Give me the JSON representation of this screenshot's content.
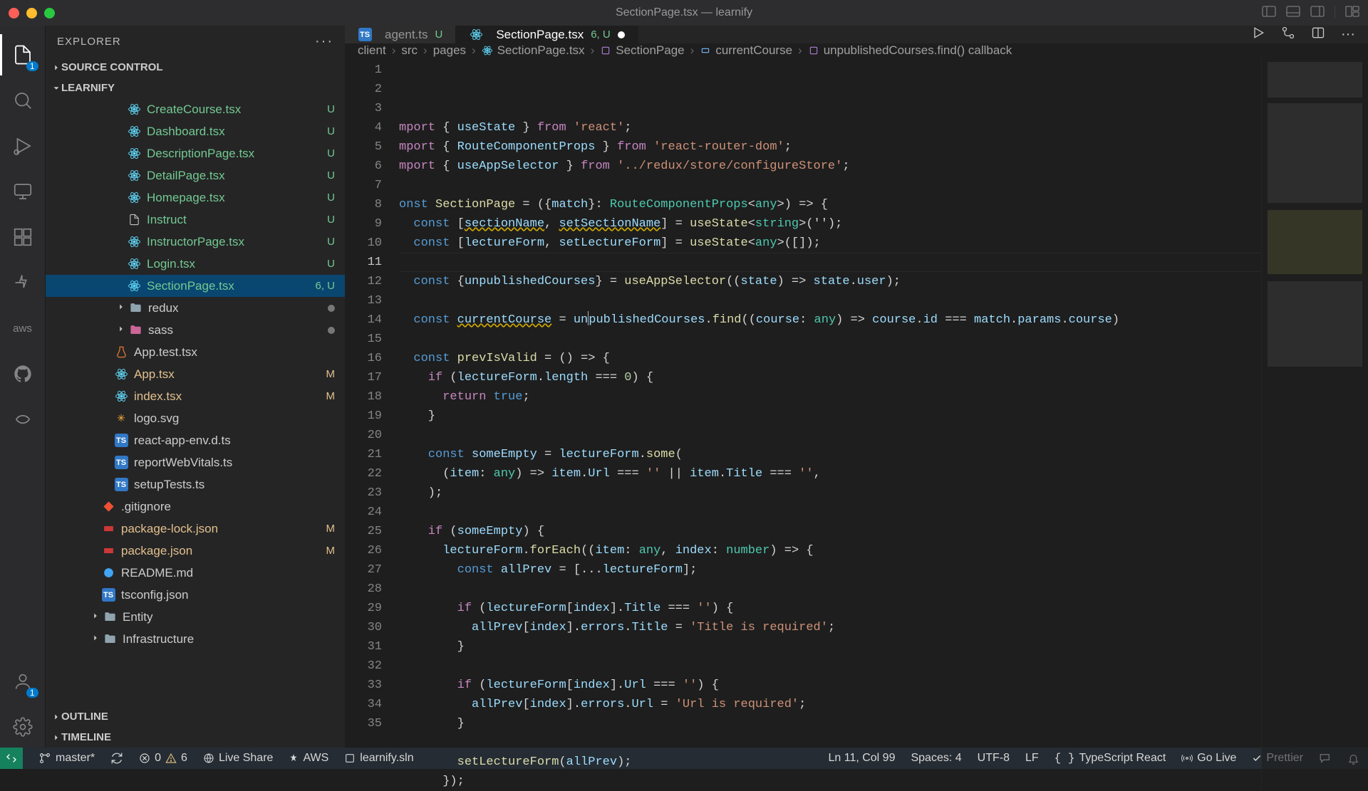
{
  "title": "SectionPage.tsx — learnify",
  "activity": {
    "explorer_badge": "1",
    "accounts_badge": "1"
  },
  "explorer": {
    "title": "EXPLORER",
    "sections": {
      "source_control": "SOURCE CONTROL",
      "project": "LEARNIFY",
      "outline": "OUTLINE",
      "timeline": "TIMELINE"
    },
    "tree_scm_redux": "●",
    "tree_scm_sass": "●",
    "items": [
      {
        "label": "CreateCourse.tsx",
        "indent": 114,
        "icon": "react",
        "scm": "U"
      },
      {
        "label": "Dashboard.tsx",
        "indent": 114,
        "icon": "react",
        "scm": "U"
      },
      {
        "label": "DescriptionPage.tsx",
        "indent": 114,
        "icon": "react",
        "scm": "U"
      },
      {
        "label": "DetailPage.tsx",
        "indent": 114,
        "icon": "react",
        "scm": "U"
      },
      {
        "label": "Homepage.tsx",
        "indent": 114,
        "icon": "react",
        "scm": "U"
      },
      {
        "label": "Instruct",
        "indent": 114,
        "icon": "file",
        "scm": "U"
      },
      {
        "label": "InstructorPage.tsx",
        "indent": 114,
        "icon": "react",
        "scm": "U"
      },
      {
        "label": "Login.tsx",
        "indent": 114,
        "icon": "react",
        "scm": "U"
      },
      {
        "label": "SectionPage.tsx",
        "indent": 114,
        "icon": "react",
        "scm": "6, U",
        "active": true
      },
      {
        "label": "redux",
        "indent": 96,
        "icon": "folder",
        "chev": true,
        "dot": true
      },
      {
        "label": "sass",
        "indent": 96,
        "icon": "sass-folder",
        "chev": true,
        "dot": true
      },
      {
        "label": "App.test.tsx",
        "indent": 96,
        "icon": "test",
        "scm": ""
      },
      {
        "label": "App.tsx",
        "indent": 96,
        "icon": "react",
        "scm": "M"
      },
      {
        "label": "index.tsx",
        "indent": 96,
        "icon": "react",
        "scm": "M"
      },
      {
        "label": "logo.svg",
        "indent": 96,
        "icon": "svg",
        "scm": ""
      },
      {
        "label": "react-app-env.d.ts",
        "indent": 96,
        "icon": "ts",
        "scm": ""
      },
      {
        "label": "reportWebVitals.ts",
        "indent": 96,
        "icon": "ts",
        "scm": ""
      },
      {
        "label": "setupTests.ts",
        "indent": 96,
        "icon": "ts",
        "scm": ""
      },
      {
        "label": ".gitignore",
        "indent": 78,
        "icon": "git",
        "scm": ""
      },
      {
        "label": "package-lock.json",
        "indent": 78,
        "icon": "npm",
        "scm": "M"
      },
      {
        "label": "package.json",
        "indent": 78,
        "icon": "npm",
        "scm": "M"
      },
      {
        "label": "README.md",
        "indent": 78,
        "icon": "info",
        "scm": ""
      },
      {
        "label": "tsconfig.json",
        "indent": 78,
        "icon": "tsj",
        "scm": ""
      },
      {
        "label": "Entity",
        "indent": 60,
        "icon": "folder",
        "chev": true
      },
      {
        "label": "Infrastructure",
        "indent": 60,
        "icon": "folder",
        "chev": true
      }
    ]
  },
  "tabs": [
    {
      "label": "agent.ts",
      "scm": "U",
      "icon": "ts",
      "active": false
    },
    {
      "label": "SectionPage.tsx",
      "scm": "6, U",
      "icon": "react",
      "active": true,
      "modified": true
    }
  ],
  "breadcrumbs": [
    {
      "label": "client"
    },
    {
      "label": "src"
    },
    {
      "label": "pages"
    },
    {
      "label": "SectionPage.tsx",
      "icon": "react"
    },
    {
      "label": "SectionPage",
      "icon": "symbol-method"
    },
    {
      "label": "currentCourse",
      "icon": "symbol-variable"
    },
    {
      "label": "unpublishedCourses.find() callback",
      "icon": "symbol-method"
    }
  ],
  "code": {
    "lines": [
      {
        "n": 1
      },
      {
        "n": 2
      },
      {
        "n": 3
      },
      {
        "n": 4
      },
      {
        "n": 5
      },
      {
        "n": 6
      },
      {
        "n": 7
      },
      {
        "n": 8
      },
      {
        "n": 9
      },
      {
        "n": 10
      },
      {
        "n": 11,
        "current": true
      },
      {
        "n": 12
      },
      {
        "n": 13
      },
      {
        "n": 14
      },
      {
        "n": 15
      },
      {
        "n": 16
      },
      {
        "n": 17
      },
      {
        "n": 18
      },
      {
        "n": 19
      },
      {
        "n": 20
      },
      {
        "n": 21
      },
      {
        "n": 22
      },
      {
        "n": 23
      },
      {
        "n": 24
      },
      {
        "n": 25
      },
      {
        "n": 26
      },
      {
        "n": 27
      },
      {
        "n": 28
      },
      {
        "n": 29
      },
      {
        "n": 30
      },
      {
        "n": 31
      },
      {
        "n": 32
      },
      {
        "n": 33
      },
      {
        "n": 34
      },
      {
        "n": 35
      }
    ],
    "content": {
      "l1": {
        "a": "mport",
        "b": " { ",
        "c": "useState",
        "d": " } ",
        "e": "from",
        "f": " 'react'",
        "g": ";"
      },
      "l2": {
        "a": "mport",
        "b": " { ",
        "c": "RouteComponentProps",
        "d": " } ",
        "e": "from",
        "f": " 'react-router-dom'",
        "g": ";"
      },
      "l3": {
        "a": "mport",
        "b": " { ",
        "c": "useAppSelector",
        "d": " } ",
        "e": "from",
        "f": " '../redux/store/configureStore'",
        "g": ";"
      },
      "l5": {
        "a": "onst ",
        "b": "SectionPage",
        "c": " = ({",
        "d": "match",
        "e": "}: ",
        "f": "RouteComponentProps",
        "g": "<",
        "h": "any",
        "i": ">) => {"
      },
      "l6": {
        "a": "  const ",
        "b": "[",
        "c": "sectionName",
        "d": ", ",
        "e": "setSectionName",
        "f": "] = ",
        "g": "useState",
        "h": "<",
        "i": "string",
        "j": ">('');"
      },
      "l7": {
        "a": "  const ",
        "b": "[",
        "c": "lectureForm",
        "d": ", ",
        "e": "setLectureForm",
        "f": "] = ",
        "g": "useState",
        "h": "<",
        "i": "any",
        "j": ">([]);"
      },
      "l9": {
        "a": "  const ",
        "b": "{",
        "c": "unpublishedCourses",
        "d": "} = ",
        "e": "useAppSelector",
        "f": "((",
        "g": "state",
        "h": ") => ",
        "i": "state",
        "j": ".",
        "k": "user",
        "l": ");"
      },
      "l11": {
        "a": "  const ",
        "b": "currentCourse",
        "c": " = ",
        "d": "unpublishedCourses",
        "e": ".",
        "f": "find",
        "g": "((",
        "h": "course",
        "i": ": ",
        "j": "any",
        "k": ") => ",
        "l": "course",
        "m": ".",
        "n": "id",
        "o": " === ",
        "p": "match",
        "q": ".",
        "r": "params",
        "s": ".",
        "t": "course",
        "u": ")"
      },
      "l13": {
        "a": "  const ",
        "b": "prevIsValid",
        "c": " = () => {"
      },
      "l14": {
        "a": "    if ",
        "b": "(",
        "c": "lectureForm",
        "d": ".",
        "e": "length",
        "f": " === ",
        "g": "0",
        "h": ") {"
      },
      "l15": {
        "a": "      return ",
        "b": "true",
        "c": ";"
      },
      "l16": "    }",
      "l18": {
        "a": "    const ",
        "b": "someEmpty",
        "c": " = ",
        "d": "lectureForm",
        "e": ".",
        "f": "some",
        "g": "("
      },
      "l19": {
        "a": "      (",
        "b": "item",
        "c": ": ",
        "d": "any",
        "e": ") => ",
        "f": "item",
        "g": ".",
        "h": "Url",
        "i": " === ",
        "j": "''",
        "k": " || ",
        "l": "item",
        "m": ".",
        "n": "Title",
        "o": " === ",
        "p": "''",
        "q": ","
      },
      "l20": "    );",
      "l22": {
        "a": "    if ",
        "b": "(",
        "c": "someEmpty",
        "d": ") {"
      },
      "l23": {
        "a": "      lectureForm",
        "b": ".",
        "c": "forEach",
        "d": "((",
        "e": "item",
        "f": ": ",
        "g": "any",
        "h": ", ",
        "i": "index",
        "j": ": ",
        "k": "number",
        "l": ") => {"
      },
      "l24": {
        "a": "        const ",
        "b": "allPrev",
        "c": " = [...",
        "d": "lectureForm",
        "e": "];"
      },
      "l26": {
        "a": "        if ",
        "b": "(",
        "c": "lectureForm",
        "d": "[",
        "e": "index",
        "f": "].",
        "g": "Title",
        "h": " === ",
        "i": "''",
        "j": ") {"
      },
      "l27": {
        "a": "          allPrev",
        "b": "[",
        "c": "index",
        "d": "].",
        "e": "errors",
        "f": ".",
        "g": "Title",
        "h": " = ",
        "i": "'Title is required'",
        "j": ";"
      },
      "l28": "        }",
      "l30": {
        "a": "        if ",
        "b": "(",
        "c": "lectureForm",
        "d": "[",
        "e": "index",
        "f": "].",
        "g": "Url",
        "h": " === ",
        "i": "''",
        "j": ") {"
      },
      "l31": {
        "a": "          allPrev",
        "b": "[",
        "c": "index",
        "d": "].",
        "e": "errors",
        "f": ".",
        "g": "Url",
        "h": " = ",
        "i": "'Url is required'",
        "j": ";"
      },
      "l32": "        }",
      "l34": {
        "a": "        setLectureForm",
        "b": "(",
        "c": "allPrev",
        "d": ");"
      },
      "l35": "      });"
    }
  },
  "status": {
    "remote": "",
    "branch": "master*",
    "errors": "0",
    "warnings": "6",
    "liveshare": "Live Share",
    "aws": "AWS",
    "sln": "learnify.sln",
    "lncol": "Ln 11, Col 99",
    "spaces": "Spaces: 4",
    "encoding": "UTF-8",
    "eol": "LF",
    "lang": "TypeScript React",
    "golive": "Go Live",
    "prettier": "Prettier"
  }
}
